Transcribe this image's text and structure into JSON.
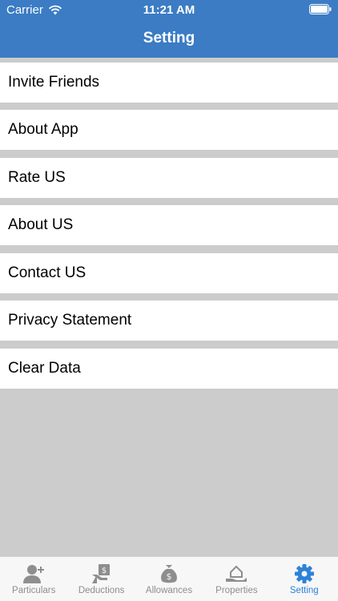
{
  "status_bar": {
    "carrier": "Carrier",
    "time": "11:21 AM"
  },
  "nav": {
    "title": "Setting"
  },
  "menu": {
    "items": [
      {
        "label": "Invite Friends"
      },
      {
        "label": "About App"
      },
      {
        "label": "Rate US"
      },
      {
        "label": "About US"
      },
      {
        "label": "Contact US"
      },
      {
        "label": "Privacy Statement"
      },
      {
        "label": "Clear Data"
      }
    ]
  },
  "tabbar": {
    "tabs": [
      {
        "label": "Particulars",
        "icon": "user-plus-icon"
      },
      {
        "label": "Deductions",
        "icon": "hand-money-icon"
      },
      {
        "label": "Allowances",
        "icon": "money-bag-icon"
      },
      {
        "label": "Properties",
        "icon": "house-hand-icon"
      },
      {
        "label": "Setting",
        "icon": "gear-icon"
      }
    ],
    "active": "Setting",
    "active_color": "#2d82d8",
    "inactive_color": "#8e8e8e"
  },
  "colors": {
    "header": "#3b7cc4",
    "background": "#cccccc"
  }
}
